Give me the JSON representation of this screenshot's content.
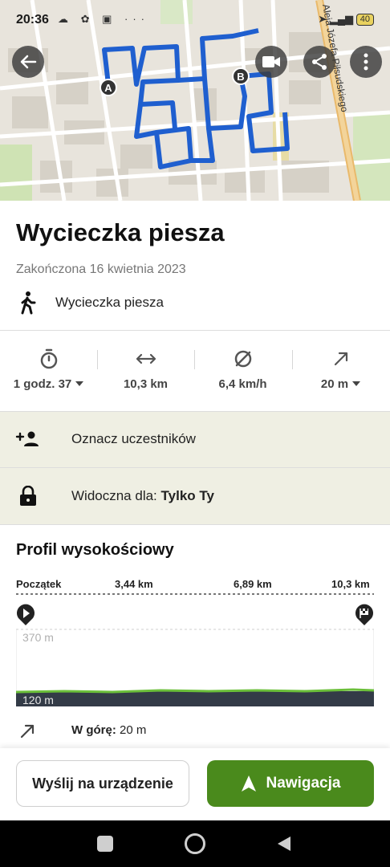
{
  "status_bar": {
    "time": "20:36",
    "icons_left": "☁ ✿ ▣ ···",
    "battery": "40"
  },
  "map": {
    "marker_a": "A",
    "marker_b": "B",
    "street_label": "Aleja Józefa Piłsudskiego",
    "route_color": "#1f5fcf",
    "buttons": [
      "back-icon",
      "video-icon",
      "share-icon",
      "more-icon"
    ]
  },
  "header": {
    "title": "Wycieczka piesza",
    "date": "Zakończona 16 kwietnia 2023",
    "activity_label": "Wycieczka piesza",
    "activity_icon": "hiker-icon"
  },
  "stats": {
    "duration": "1 godz. 37",
    "distance": "10,3 km",
    "speed": "6,4 km/h",
    "elevation": "20 m"
  },
  "rows": {
    "tag_participants": "Oznacz uczestników",
    "visibility_prefix": "Widoczna dla:",
    "visibility_value": "Tylko Ty"
  },
  "profile": {
    "title": "Profil wysokościowy",
    "ticks": [
      "Początek",
      "3,44 km",
      "6,89 km",
      "10,3 km"
    ],
    "elev_max": "370 m",
    "elev_min": "120 m",
    "up_label": "W górę:",
    "up_value": "20 m",
    "accent_color": "#6bbf3a"
  },
  "buttons": {
    "send": "Wyślij na urządzenie",
    "navigate": "Nawigacja",
    "nav_color": "#4a8a1c"
  }
}
